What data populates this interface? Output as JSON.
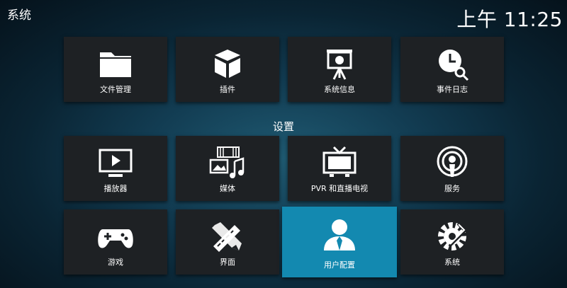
{
  "header": {
    "title": "系统",
    "clock": "上午 11:25"
  },
  "section_label": "设置",
  "row1": [
    {
      "label": "文件管理",
      "icon": "folder-icon"
    },
    {
      "label": "插件",
      "icon": "box-icon"
    },
    {
      "label": "系统信息",
      "icon": "presentation-icon"
    },
    {
      "label": "事件日志",
      "icon": "clock-search-icon"
    }
  ],
  "row2": [
    {
      "label": "播放器",
      "icon": "tv-play-icon"
    },
    {
      "label": "媒体",
      "icon": "media-icon"
    },
    {
      "label": "PVR 和直播电视",
      "icon": "tv-antenna-icon"
    },
    {
      "label": "服务",
      "icon": "podcast-icon"
    }
  ],
  "row3": [
    {
      "label": "游戏",
      "icon": "gamepad-icon"
    },
    {
      "label": "界面",
      "icon": "pencil-ruler-icon"
    },
    {
      "label": "用户配置",
      "icon": "user-icon"
    },
    {
      "label": "系统",
      "icon": "gear-wrench-icon"
    }
  ],
  "focused_tile": "用户配置",
  "colors": {
    "tile": "#1e2124",
    "focus": "#1389b0"
  }
}
